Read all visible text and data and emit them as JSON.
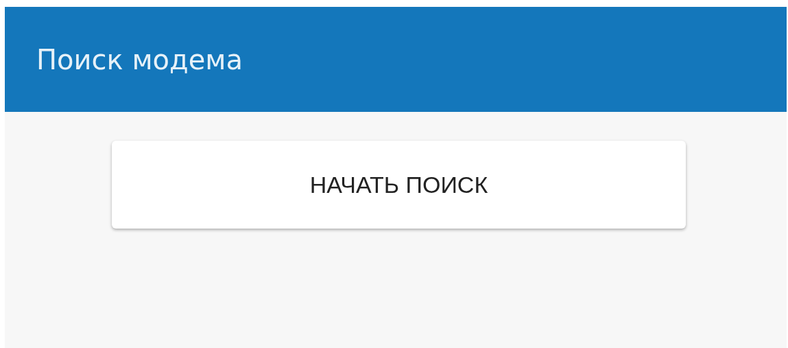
{
  "app_bar": {
    "title": "Поиск модема"
  },
  "buttons": [
    {
      "label": "НАЧАТЬ ПОИСК"
    }
  ]
}
